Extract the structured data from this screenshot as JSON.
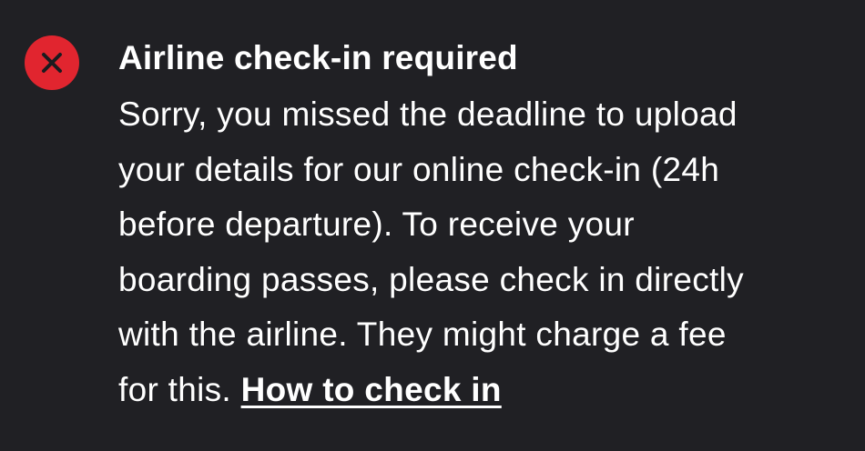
{
  "alert": {
    "icon": "close-icon",
    "icon_color": "#e1252f",
    "background_color": "#202024",
    "title": "Airline check-in required",
    "body_lines": [
      "Sorry, you missed the deadline to upload",
      "your details for our online check-in (24h",
      "before departure). To receive your",
      "boarding passes, please check in directly",
      "with the airline. They might charge a fee"
    ],
    "last_line_text": "for this. ",
    "link_label": "How to check in"
  }
}
